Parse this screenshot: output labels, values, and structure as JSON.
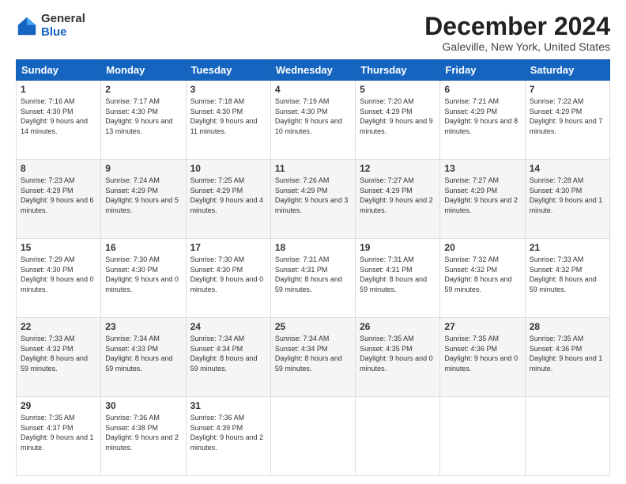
{
  "logo": {
    "general": "General",
    "blue": "Blue"
  },
  "title": "December 2024",
  "subtitle": "Galeville, New York, United States",
  "days_of_week": [
    "Sunday",
    "Monday",
    "Tuesday",
    "Wednesday",
    "Thursday",
    "Friday",
    "Saturday"
  ],
  "weeks": [
    [
      {
        "day": "1",
        "sunrise": "7:16 AM",
        "sunset": "4:30 PM",
        "daylight": "9 hours and 14 minutes."
      },
      {
        "day": "2",
        "sunrise": "7:17 AM",
        "sunset": "4:30 PM",
        "daylight": "9 hours and 13 minutes."
      },
      {
        "day": "3",
        "sunrise": "7:18 AM",
        "sunset": "4:30 PM",
        "daylight": "9 hours and 11 minutes."
      },
      {
        "day": "4",
        "sunrise": "7:19 AM",
        "sunset": "4:30 PM",
        "daylight": "9 hours and 10 minutes."
      },
      {
        "day": "5",
        "sunrise": "7:20 AM",
        "sunset": "4:29 PM",
        "daylight": "9 hours and 9 minutes."
      },
      {
        "day": "6",
        "sunrise": "7:21 AM",
        "sunset": "4:29 PM",
        "daylight": "9 hours and 8 minutes."
      },
      {
        "day": "7",
        "sunrise": "7:22 AM",
        "sunset": "4:29 PM",
        "daylight": "9 hours and 7 minutes."
      }
    ],
    [
      {
        "day": "8",
        "sunrise": "7:23 AM",
        "sunset": "4:29 PM",
        "daylight": "9 hours and 6 minutes."
      },
      {
        "day": "9",
        "sunrise": "7:24 AM",
        "sunset": "4:29 PM",
        "daylight": "9 hours and 5 minutes."
      },
      {
        "day": "10",
        "sunrise": "7:25 AM",
        "sunset": "4:29 PM",
        "daylight": "9 hours and 4 minutes."
      },
      {
        "day": "11",
        "sunrise": "7:26 AM",
        "sunset": "4:29 PM",
        "daylight": "9 hours and 3 minutes."
      },
      {
        "day": "12",
        "sunrise": "7:27 AM",
        "sunset": "4:29 PM",
        "daylight": "9 hours and 2 minutes."
      },
      {
        "day": "13",
        "sunrise": "7:27 AM",
        "sunset": "4:29 PM",
        "daylight": "9 hours and 2 minutes."
      },
      {
        "day": "14",
        "sunrise": "7:28 AM",
        "sunset": "4:30 PM",
        "daylight": "9 hours and 1 minute."
      }
    ],
    [
      {
        "day": "15",
        "sunrise": "7:29 AM",
        "sunset": "4:30 PM",
        "daylight": "9 hours and 0 minutes."
      },
      {
        "day": "16",
        "sunrise": "7:30 AM",
        "sunset": "4:30 PM",
        "daylight": "9 hours and 0 minutes."
      },
      {
        "day": "17",
        "sunrise": "7:30 AM",
        "sunset": "4:30 PM",
        "daylight": "9 hours and 0 minutes."
      },
      {
        "day": "18",
        "sunrise": "7:31 AM",
        "sunset": "4:31 PM",
        "daylight": "8 hours and 59 minutes."
      },
      {
        "day": "19",
        "sunrise": "7:31 AM",
        "sunset": "4:31 PM",
        "daylight": "8 hours and 59 minutes."
      },
      {
        "day": "20",
        "sunrise": "7:32 AM",
        "sunset": "4:32 PM",
        "daylight": "8 hours and 59 minutes."
      },
      {
        "day": "21",
        "sunrise": "7:33 AM",
        "sunset": "4:32 PM",
        "daylight": "8 hours and 59 minutes."
      }
    ],
    [
      {
        "day": "22",
        "sunrise": "7:33 AM",
        "sunset": "4:32 PM",
        "daylight": "8 hours and 59 minutes."
      },
      {
        "day": "23",
        "sunrise": "7:34 AM",
        "sunset": "4:33 PM",
        "daylight": "8 hours and 59 minutes."
      },
      {
        "day": "24",
        "sunrise": "7:34 AM",
        "sunset": "4:34 PM",
        "daylight": "8 hours and 59 minutes."
      },
      {
        "day": "25",
        "sunrise": "7:34 AM",
        "sunset": "4:34 PM",
        "daylight": "8 hours and 59 minutes."
      },
      {
        "day": "26",
        "sunrise": "7:35 AM",
        "sunset": "4:35 PM",
        "daylight": "9 hours and 0 minutes."
      },
      {
        "day": "27",
        "sunrise": "7:35 AM",
        "sunset": "4:36 PM",
        "daylight": "9 hours and 0 minutes."
      },
      {
        "day": "28",
        "sunrise": "7:35 AM",
        "sunset": "4:36 PM",
        "daylight": "9 hours and 1 minute."
      }
    ],
    [
      {
        "day": "29",
        "sunrise": "7:35 AM",
        "sunset": "4:37 PM",
        "daylight": "9 hours and 1 minute."
      },
      {
        "day": "30",
        "sunrise": "7:36 AM",
        "sunset": "4:38 PM",
        "daylight": "9 hours and 2 minutes."
      },
      {
        "day": "31",
        "sunrise": "7:36 AM",
        "sunset": "4:39 PM",
        "daylight": "9 hours and 2 minutes."
      },
      null,
      null,
      null,
      null
    ]
  ]
}
